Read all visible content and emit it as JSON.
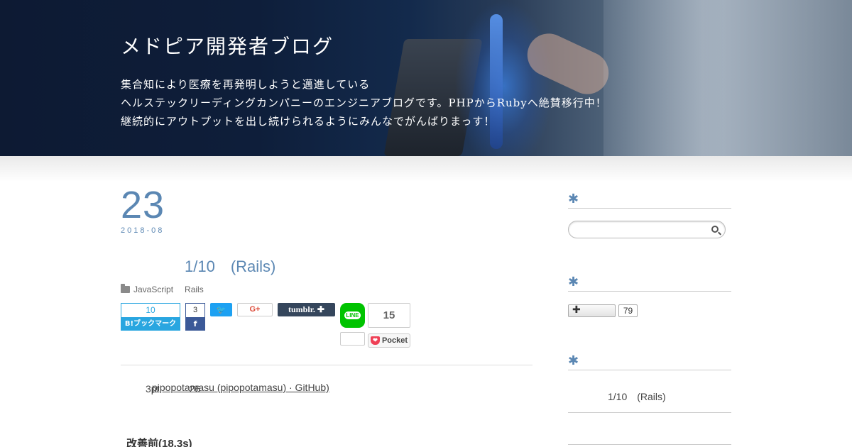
{
  "header": {
    "title": "メドピア開発者ブログ",
    "description": [
      "集合知により医療を再発明しようと邁進している",
      "ヘルステックリーディングカンパニーのエンジニアブログです。PHPからRubyへ絶賛移行中！",
      "継続的にアウトプットを出し続けられるようにみんなでがんばりまっす！"
    ]
  },
  "post": {
    "day": "23",
    "year_month": "2018-08",
    "title": "1/10　(Rails)",
    "categories": [
      "JavaScript",
      "Rails"
    ],
    "body_line_prefix": "3pt　　　26",
    "body_link": "pipopotamasu (pipopotamasu) · GitHub)",
    "section_heading": "改善前(18.3s)"
  },
  "share": {
    "hatena": {
      "count": "10",
      "label": "B!ブックマーク"
    },
    "facebook": {
      "count": "3",
      "label": "f"
    },
    "twitter": {
      "label": "🐦"
    },
    "gplus": {
      "label": "G+"
    },
    "tumblr": {
      "label": "tumblr. ✚"
    },
    "line": {
      "label": "LINE"
    },
    "pocket": {
      "count": "15",
      "label": "Pocket",
      "icon": "❤"
    }
  },
  "sidebar": {
    "section_marker": "✱",
    "follow": {
      "label": "✚",
      "count": "79"
    },
    "recent_post": "1/10　(Rails)"
  },
  "colors": {
    "accent": "#5b87b3",
    "hatena": "#29a6e0",
    "facebook": "#3b5998",
    "twitter": "#1da1f2",
    "tumblr": "#35465c",
    "line": "#00c300",
    "pocket": "#ef4056"
  }
}
